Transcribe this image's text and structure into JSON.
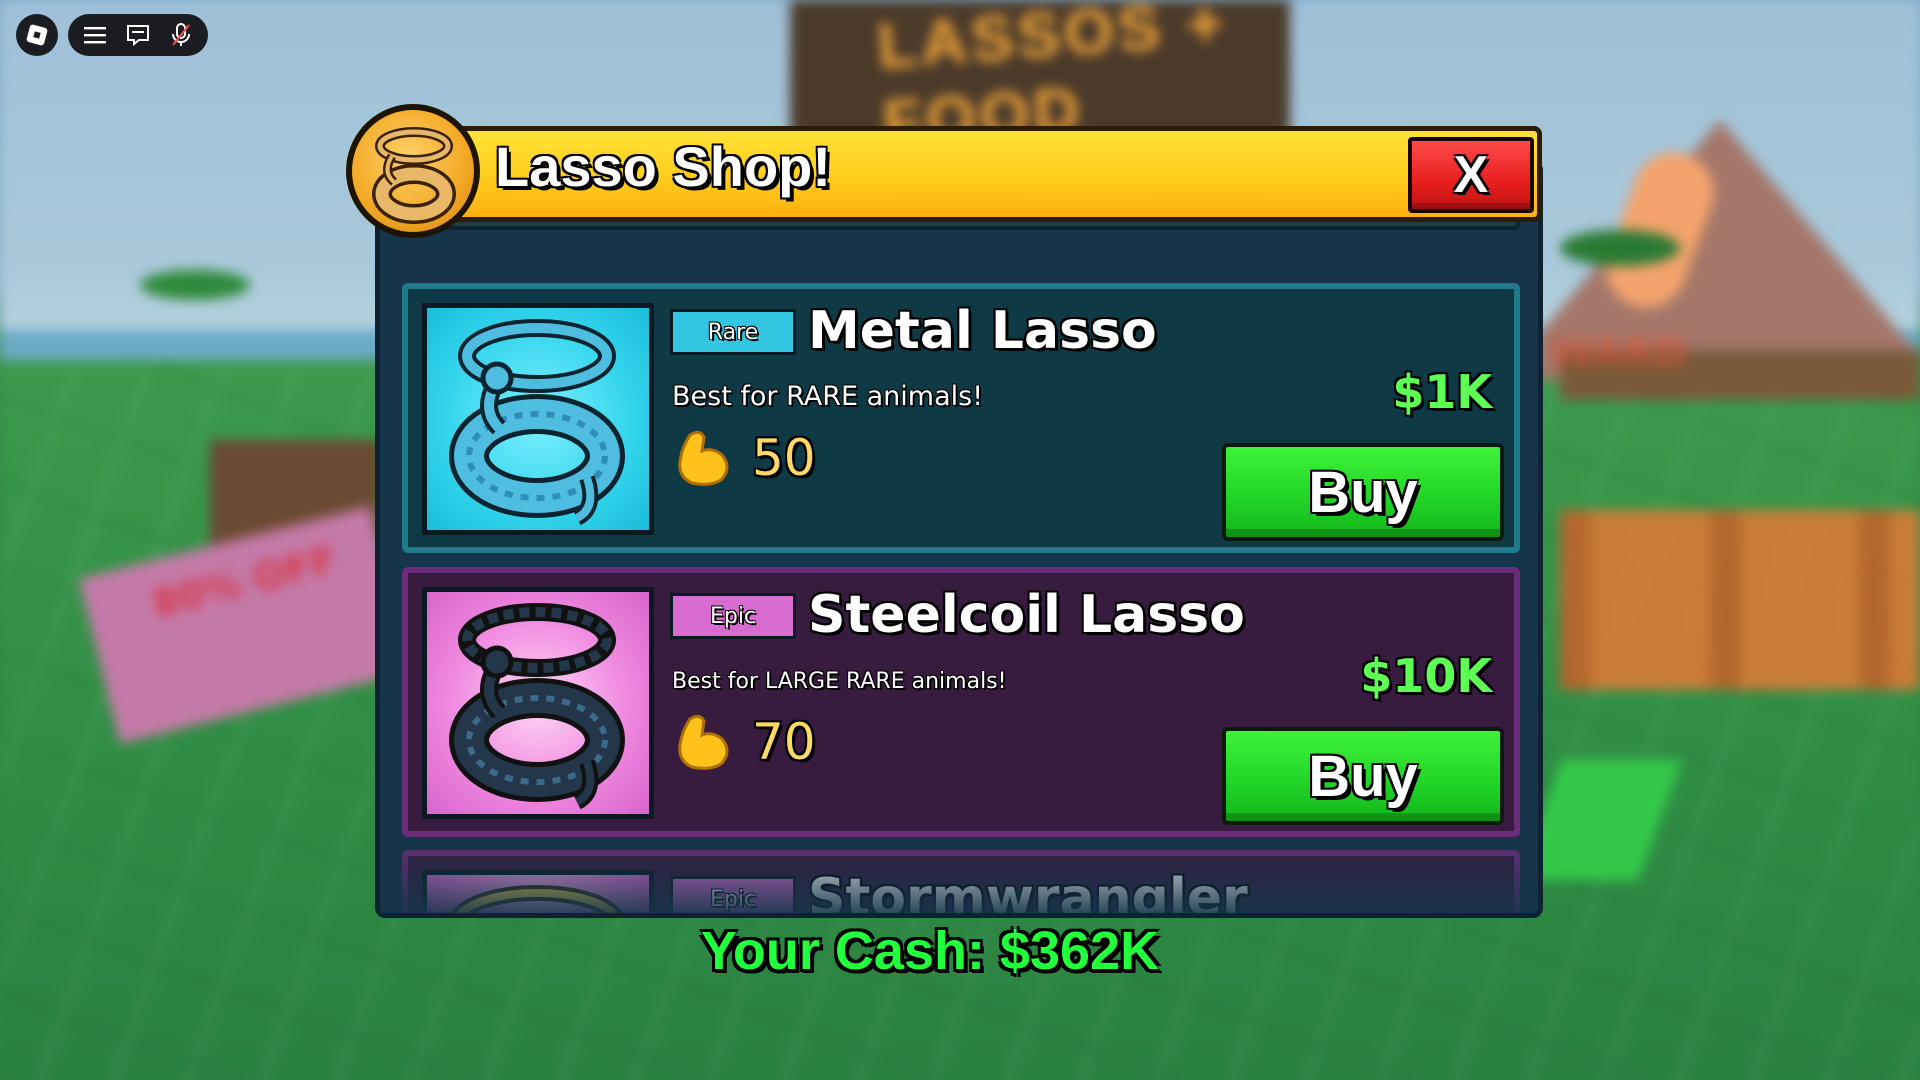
{
  "background": {
    "sign_text": "LASSOS + FOOD",
    "banner_text": "80% OFF"
  },
  "topbar": {
    "icons": [
      "roblox-logo-icon",
      "menu-icon",
      "chat-icon",
      "microphone-icon"
    ]
  },
  "shop": {
    "title": "Lasso Shop!",
    "close_label": "X",
    "items": [
      {
        "rarity": "Rare",
        "name": "Metal Lasso",
        "description": "Best for RARE animals!",
        "strength": "50",
        "price": "$1K",
        "buy_label": "Buy",
        "theme_color": "#33c6e0"
      },
      {
        "rarity": "Epic",
        "name": "Steelcoil Lasso",
        "description": "Best for LARGE RARE animals!",
        "strength": "70",
        "price": "$10K",
        "buy_label": "Buy",
        "theme_color": "#d76bd0"
      },
      {
        "rarity": "Epic",
        "name": "Stormwrangler"
      }
    ]
  },
  "cash": {
    "label": "Your Cash: $362K"
  },
  "colors": {
    "header_yellow": "#ffcf1e",
    "close_red": "#e81f1f",
    "buy_green": "#22d628",
    "cash_green": "#22ff3c",
    "strength_yellow": "#ffd966"
  }
}
